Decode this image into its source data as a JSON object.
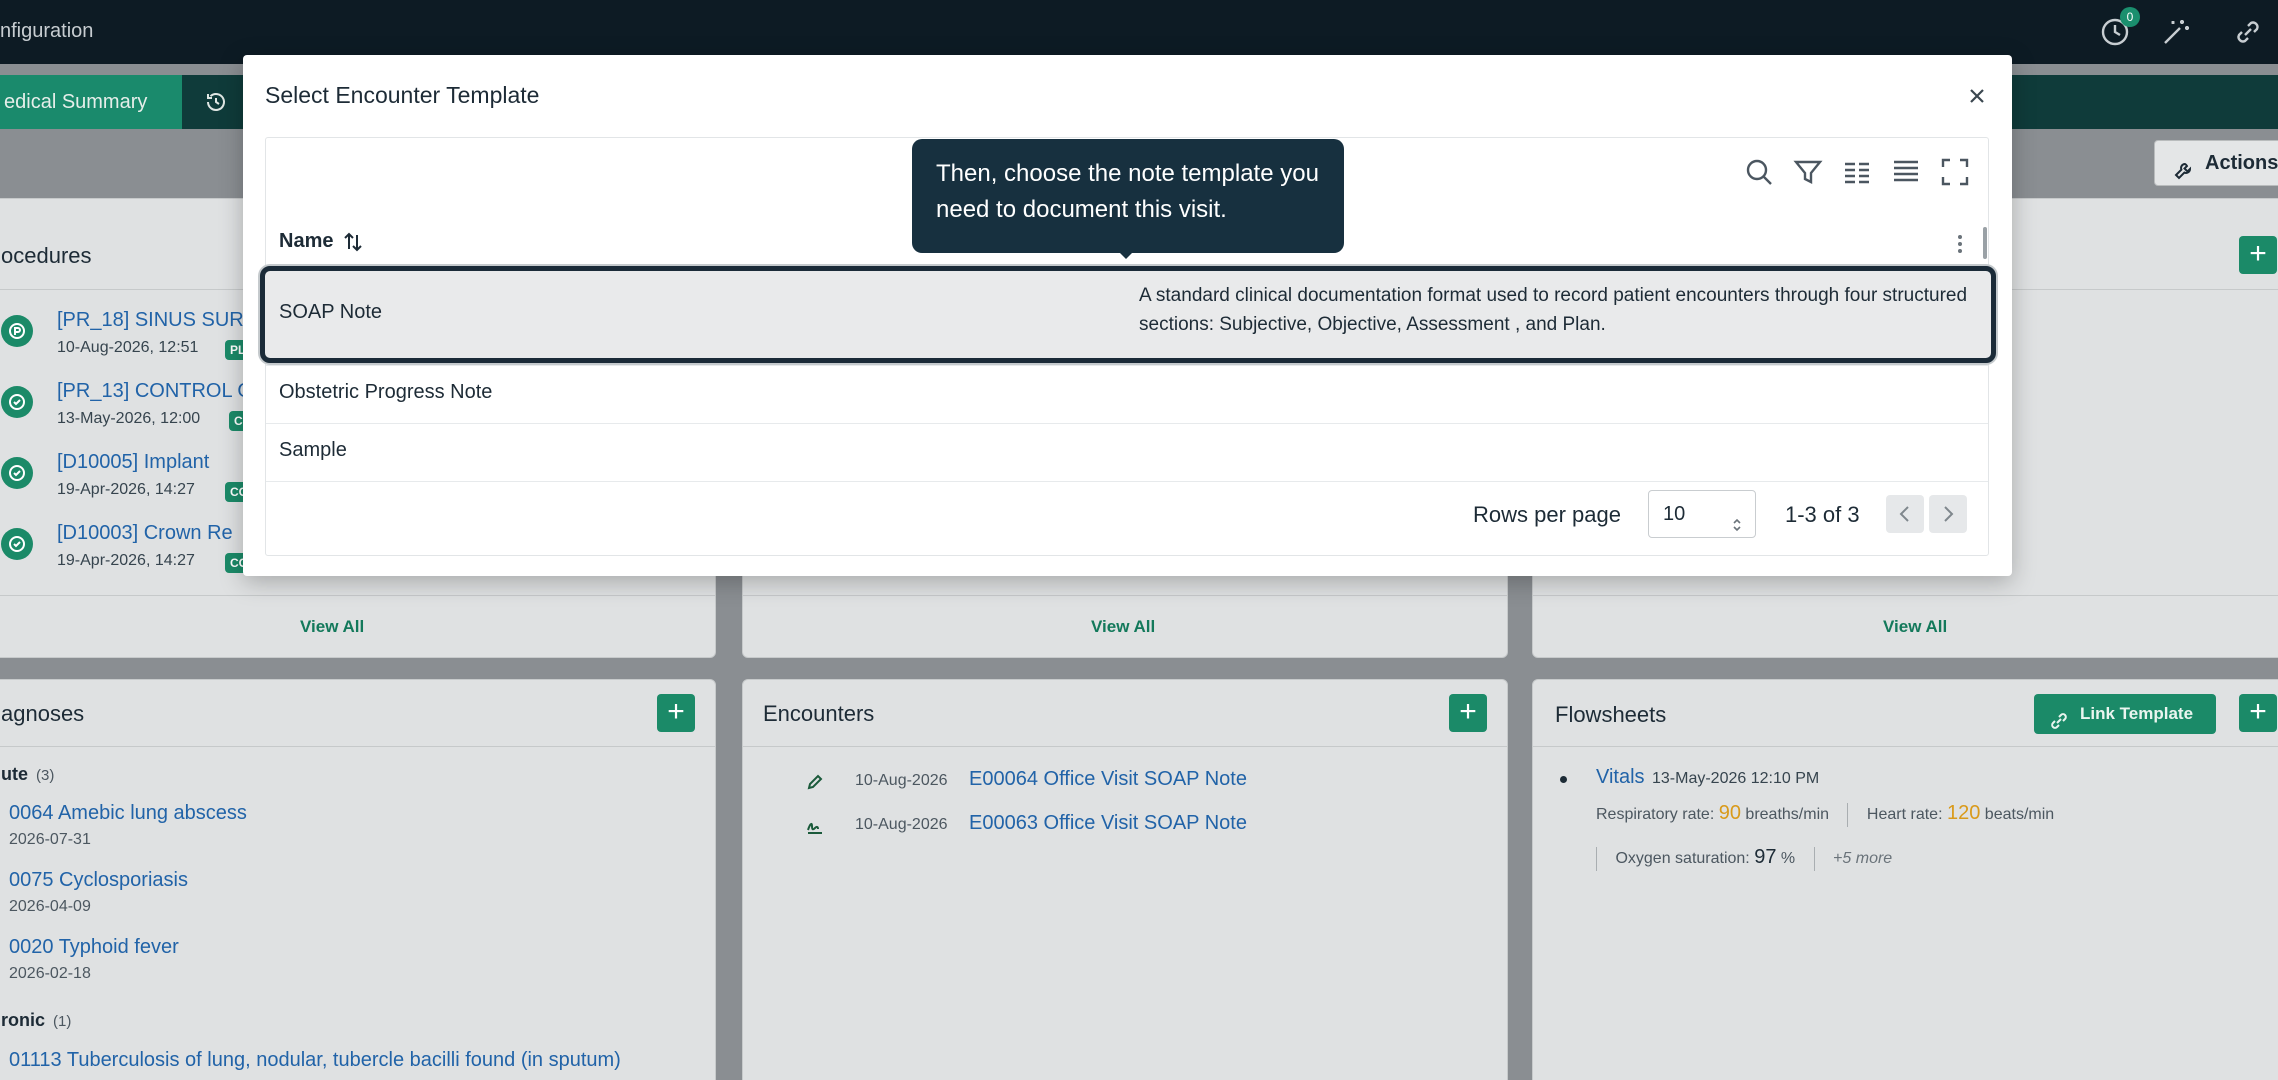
{
  "topbar": {
    "title": "nfiguration",
    "history_badge": "0"
  },
  "tabs": {
    "active_label": "edical Summary"
  },
  "actions_label": "Actions",
  "procedures": {
    "title": "ocedures",
    "items": [
      {
        "title": "[PR_18] SINUS SUR",
        "date": "10-Aug-2026, 12:51",
        "chip": "PL"
      },
      {
        "title": "[PR_13] CONTROL O",
        "date": "13-May-2026, 12:00",
        "chip": "C"
      },
      {
        "title": "[D10005] Implant",
        "date": "19-Apr-2026, 14:27",
        "chip": "CC"
      },
      {
        "title": "[D10003] Crown Re",
        "date": "19-Apr-2026, 14:27",
        "chip": "CC"
      }
    ],
    "view_all": "View All"
  },
  "middle_card": {
    "view_all": "View All"
  },
  "right_card": {
    "view_all": "View All"
  },
  "diagnoses": {
    "title": "agnoses",
    "acute_label": "ute",
    "acute_count": "(3)",
    "acute_items": [
      {
        "title": "0064 Amebic lung abscess",
        "date": "2026-07-31"
      },
      {
        "title": "0075 Cyclosporiasis",
        "date": "2026-04-09"
      },
      {
        "title": "0020 Typhoid fever",
        "date": "2026-02-18"
      }
    ],
    "chronic_label": "ronic",
    "chronic_count": "(1)",
    "chronic_items": [
      {
        "title": "01113 Tuberculosis of lung, nodular, tubercle bacilli found (in sputum)"
      }
    ]
  },
  "encounters": {
    "title": "Encounters",
    "items": [
      {
        "date": "10-Aug-2026",
        "title": "E00064 Office Visit SOAP Note",
        "icon": "pencil-icon"
      },
      {
        "date": "10-Aug-2026",
        "title": "E00063 Office Visit SOAP Note",
        "icon": "signature-icon"
      }
    ]
  },
  "flowsheets": {
    "title": "Flowsheets",
    "link_template_label": "Link Template",
    "vitals": {
      "title": "Vitals",
      "time": "13-May-2026 12:10 PM",
      "resp_label": "Respiratory rate:",
      "resp_value": "90",
      "resp_unit": "breaths/min",
      "hr_label": "Heart rate:",
      "hr_value": "120",
      "hr_unit": "beats/min",
      "ox_label": "Oxygen saturation:",
      "ox_value": "97",
      "ox_unit": "%",
      "more": "+5 more"
    }
  },
  "modal": {
    "title": "Select Encounter Template",
    "column_name": "Name",
    "rows": [
      {
        "name": "SOAP Note",
        "description": "A standard clinical documentation format used to record patient encounters through four structured sections: Subjective, Objective, Assessment , and Plan."
      },
      {
        "name": "Obstetric Progress Note",
        "description": ""
      },
      {
        "name": "Sample",
        "description": ""
      }
    ],
    "rows_per_page_label": "Rows per page",
    "rows_per_page_value": "10",
    "page_info": "1-3 of 3"
  },
  "tooltip": {
    "text": "Then, choose the note template you need to document this visit."
  },
  "colors": {
    "accent_green": "#1b8a68",
    "link_blue": "#2163a8",
    "dark_navy": "#17303f"
  }
}
